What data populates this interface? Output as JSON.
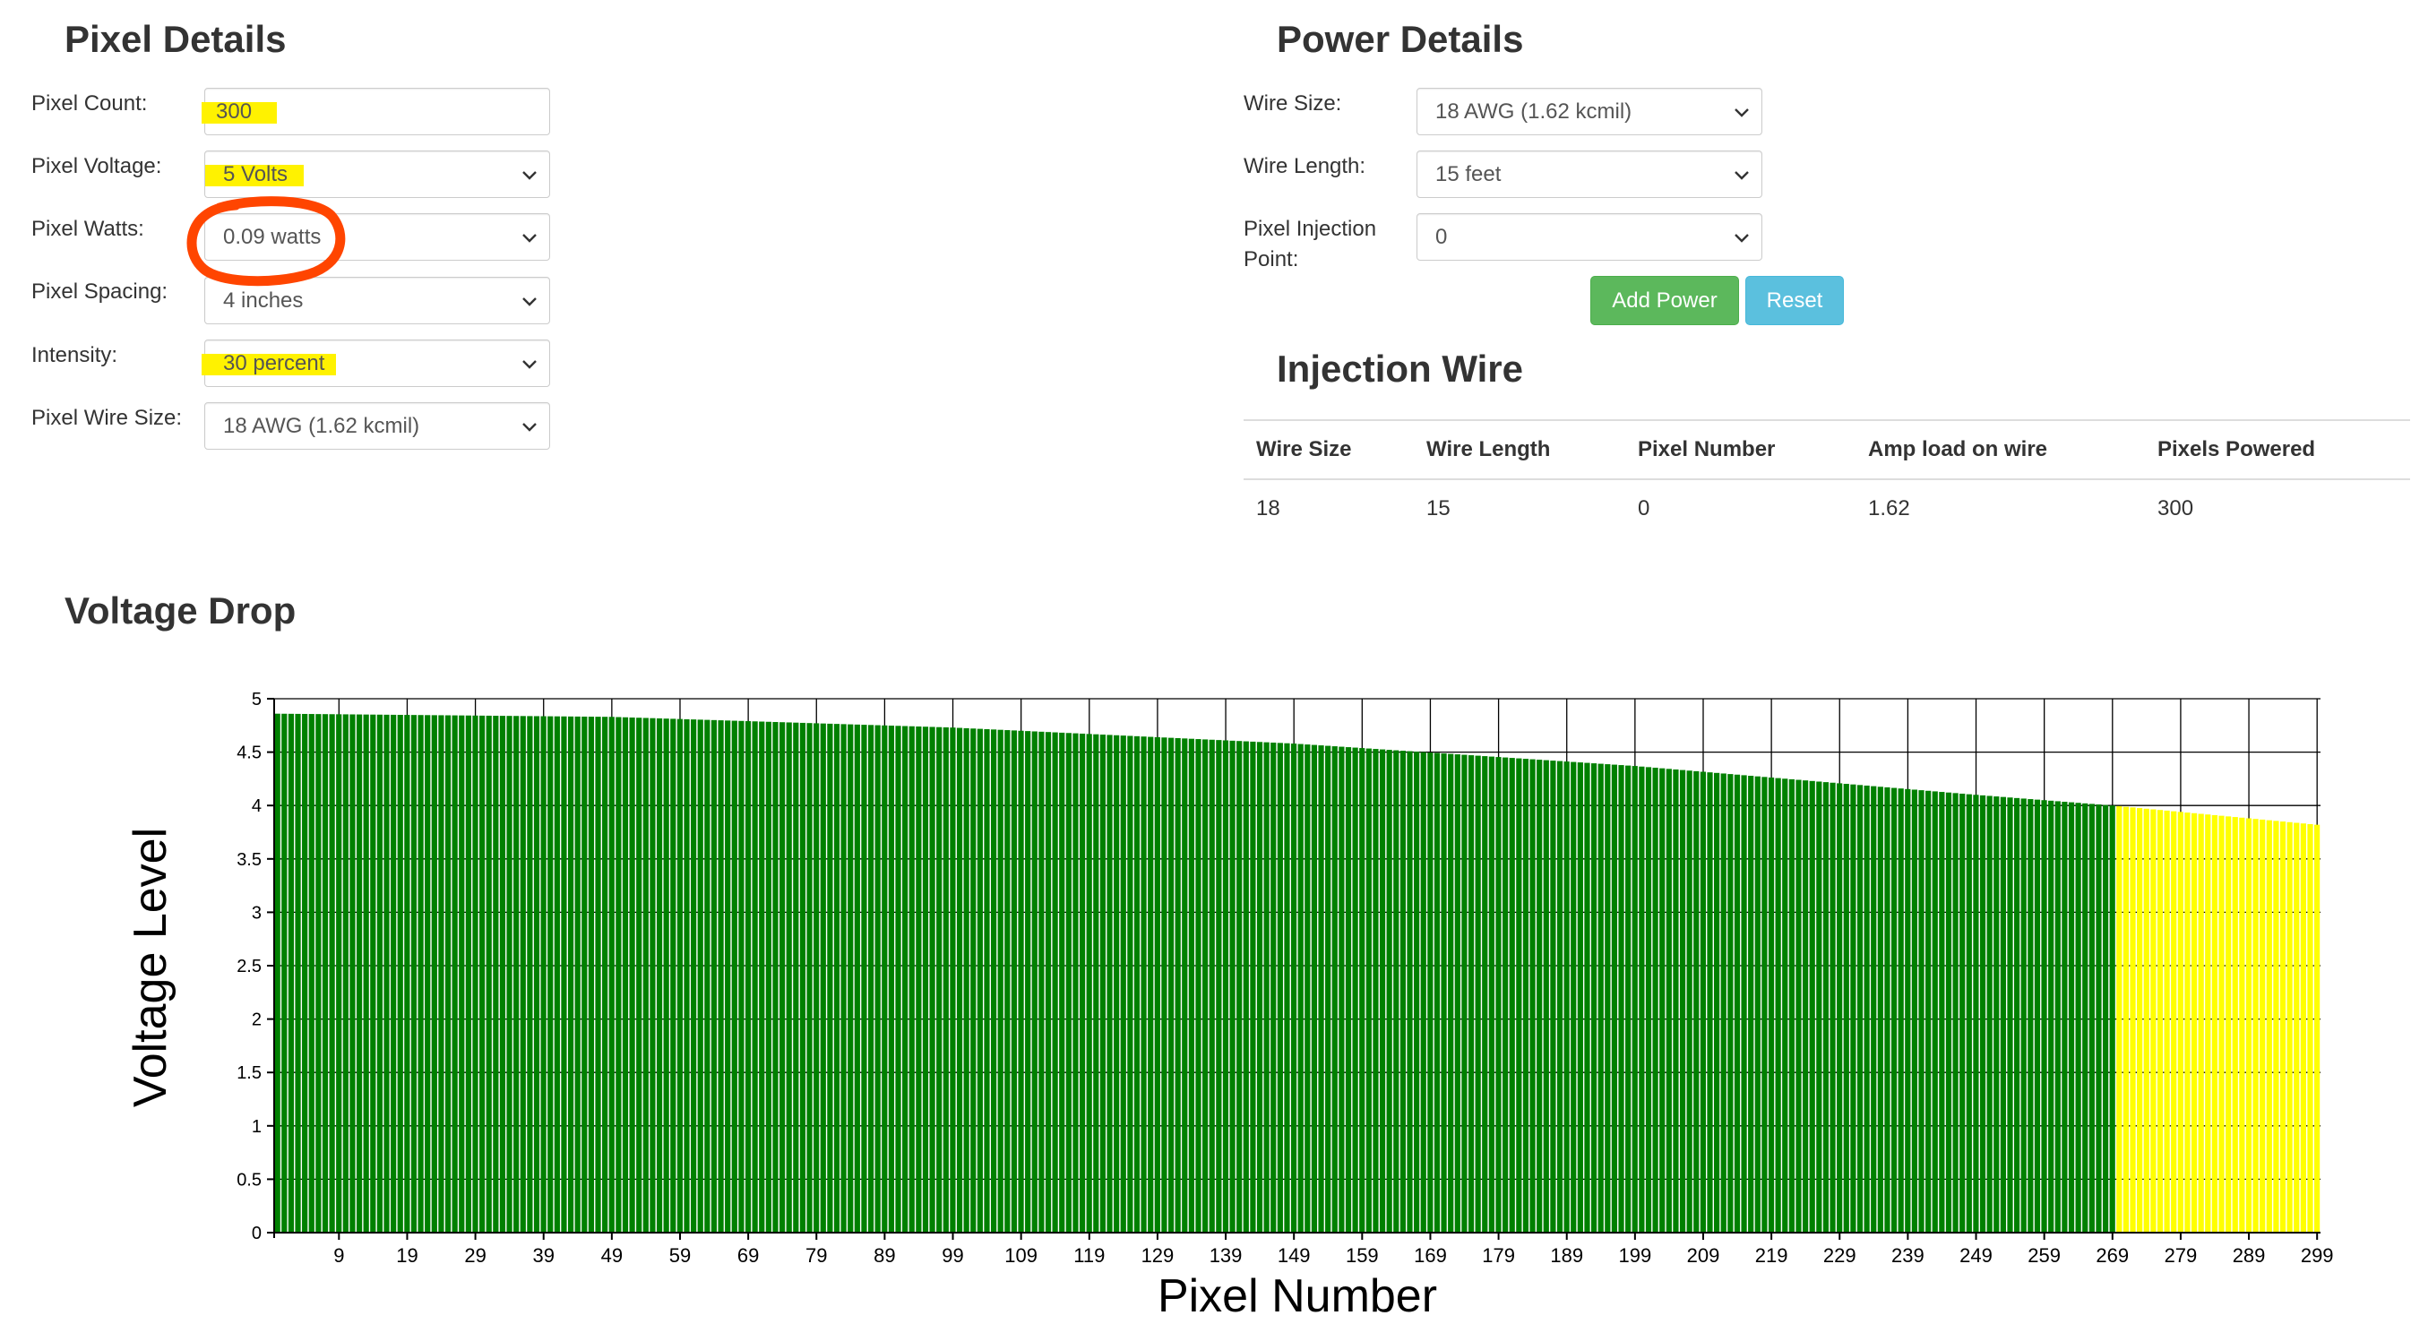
{
  "pixel_details": {
    "title": "Pixel Details",
    "fields": [
      {
        "label": "Pixel Count:",
        "value": "300",
        "type": "input",
        "highlight": "yellow"
      },
      {
        "label": "Pixel Voltage:",
        "value": "5 Volts",
        "type": "select",
        "highlight": "yellow"
      },
      {
        "label": "Pixel Watts:",
        "value": "0.09 watts",
        "type": "select",
        "highlight": "red-circle"
      },
      {
        "label": "Pixel Spacing:",
        "value": "4 inches",
        "type": "select"
      },
      {
        "label": "Intensity:",
        "value": "30 percent",
        "type": "select",
        "highlight": "yellow"
      },
      {
        "label": "Pixel Wire Size:",
        "value": "18 AWG (1.62 kcmil)",
        "type": "select"
      }
    ]
  },
  "power_details": {
    "title": "Power Details",
    "fields": [
      {
        "label": "Wire Size:",
        "value": "18 AWG (1.62 kcmil)"
      },
      {
        "label": "Wire Length:",
        "value": "15 feet"
      },
      {
        "label_line1": "Pixel Injection",
        "label_line2": "Point:",
        "value": "0"
      }
    ],
    "add_power_label": "Add Power",
    "reset_label": "Reset"
  },
  "injection_wire": {
    "title": "Injection Wire",
    "columns": [
      "Wire Size",
      "Wire Length",
      "Pixel Number",
      "Amp load on wire",
      "Pixels Powered"
    ],
    "rows": [
      [
        "18",
        "15",
        "0",
        "1.62",
        "300"
      ]
    ]
  },
  "voltage_drop": {
    "title": "Voltage Drop"
  },
  "colors": {
    "highlight_yellow": "#fff200",
    "annotation_red": "#ff4500",
    "bar_ok": "#008000",
    "bar_warn": "#ffff00",
    "button_green": "#5cb85c",
    "button_blue": "#5bc0de"
  },
  "chart_data": {
    "type": "bar",
    "xlabel": "Pixel Number",
    "ylabel": "Voltage Level",
    "ylim": [
      0,
      5
    ],
    "yticks": [
      "0",
      "0.5",
      "1",
      "1.5",
      "2",
      "2.5",
      "3",
      "3.5",
      "4",
      "4.5",
      "5"
    ],
    "xticks": [
      "9",
      "19",
      "29",
      "39",
      "49",
      "59",
      "69",
      "79",
      "89",
      "99",
      "109",
      "119",
      "129",
      "139",
      "149",
      "159",
      "169",
      "179",
      "189",
      "199",
      "209",
      "219",
      "229",
      "239",
      "249",
      "259",
      "269",
      "279",
      "289",
      "299"
    ],
    "grid": true,
    "pixel_count": 300,
    "series": [
      {
        "color": "#008000",
        "pixel_range": [
          0,
          269
        ],
        "values": {
          "start": 4.86,
          "end": 4.0
        }
      },
      {
        "color": "#ffff00",
        "pixel_range": [
          270,
          299
        ],
        "values": {
          "start": 4.0,
          "end": 3.82
        }
      }
    ],
    "sample_values": [
      {
        "x": 0,
        "y": 4.86
      },
      {
        "x": 49,
        "y": 4.83
      },
      {
        "x": 99,
        "y": 4.73
      },
      {
        "x": 149,
        "y": 4.58
      },
      {
        "x": 199,
        "y": 4.37
      },
      {
        "x": 249,
        "y": 4.1
      },
      {
        "x": 269,
        "y": 4.0
      },
      {
        "x": 299,
        "y": 3.82
      }
    ]
  }
}
